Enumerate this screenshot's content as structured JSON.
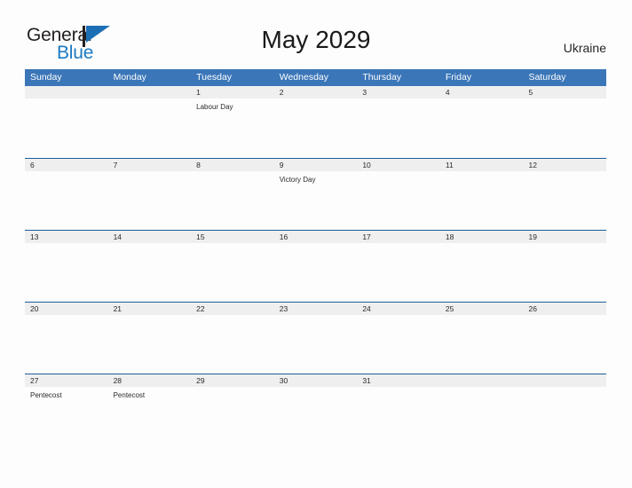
{
  "logo": {
    "word_one": "General",
    "word_two": "Blue",
    "flag_icon": "flag-triangle-icon",
    "primary_color": "#1c7ac2",
    "text_color": "#231f20"
  },
  "header": {
    "title": "May 2029",
    "country": "Ukraine"
  },
  "colors": {
    "weekday_header_bg": "#3a76b8",
    "weekday_header_text": "#ffffff",
    "date_band_bg": "#efefef",
    "row_divider": "#1f5c99",
    "page_bg": "#fdfdfd"
  },
  "calendar": {
    "weekdays": [
      "Sunday",
      "Monday",
      "Tuesday",
      "Wednesday",
      "Thursday",
      "Friday",
      "Saturday"
    ],
    "weeks": [
      {
        "days": [
          {
            "date": "",
            "events": []
          },
          {
            "date": "",
            "events": []
          },
          {
            "date": "1",
            "events": [
              "Labour Day"
            ]
          },
          {
            "date": "2",
            "events": []
          },
          {
            "date": "3",
            "events": []
          },
          {
            "date": "4",
            "events": []
          },
          {
            "date": "5",
            "events": []
          }
        ]
      },
      {
        "days": [
          {
            "date": "6",
            "events": []
          },
          {
            "date": "7",
            "events": []
          },
          {
            "date": "8",
            "events": []
          },
          {
            "date": "9",
            "events": [
              "Victory Day"
            ]
          },
          {
            "date": "10",
            "events": []
          },
          {
            "date": "11",
            "events": []
          },
          {
            "date": "12",
            "events": []
          }
        ]
      },
      {
        "days": [
          {
            "date": "13",
            "events": []
          },
          {
            "date": "14",
            "events": []
          },
          {
            "date": "15",
            "events": []
          },
          {
            "date": "16",
            "events": []
          },
          {
            "date": "17",
            "events": []
          },
          {
            "date": "18",
            "events": []
          },
          {
            "date": "19",
            "events": []
          }
        ]
      },
      {
        "days": [
          {
            "date": "20",
            "events": []
          },
          {
            "date": "21",
            "events": []
          },
          {
            "date": "22",
            "events": []
          },
          {
            "date": "23",
            "events": []
          },
          {
            "date": "24",
            "events": []
          },
          {
            "date": "25",
            "events": []
          },
          {
            "date": "26",
            "events": []
          }
        ]
      },
      {
        "days": [
          {
            "date": "27",
            "events": [
              "Pentecost"
            ]
          },
          {
            "date": "28",
            "events": [
              "Pentecost"
            ]
          },
          {
            "date": "29",
            "events": []
          },
          {
            "date": "30",
            "events": []
          },
          {
            "date": "31",
            "events": []
          },
          {
            "date": "",
            "events": []
          },
          {
            "date": "",
            "events": []
          }
        ]
      }
    ]
  }
}
